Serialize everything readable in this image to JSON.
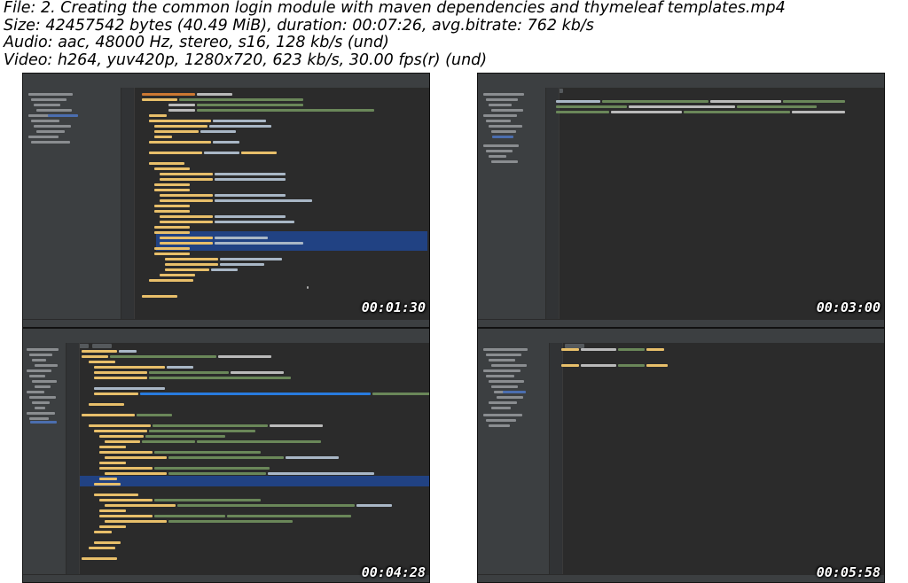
{
  "info": {
    "file_line": "File: 2. Creating the common login module with maven dependencies and thymeleaf templates.mp4",
    "size_line": "Size: 42457542 bytes (40.49 MiB), duration: 00:07:26, avg.bitrate: 762 kb/s",
    "audio_line": "Audio: aac, 48000 Hz, stereo, s16, 128 kb/s (und)",
    "video_line": "Video: h264, yuv420p, 1280x720, 623 kb/s, 30.00 fps(r) (und)"
  },
  "thumbnails": [
    {
      "timestamp": "00:01:30",
      "content": "pom.xml with maven dependencies"
    },
    {
      "timestamp": "00:03:00",
      "content": "html template with bootstrap script tags"
    },
    {
      "timestamp": "00:04:28",
      "content": "thymeleaf template with navbar and sec:authorize"
    },
    {
      "timestamp": "00:05:58",
      "content": "thymeleaf fragment header"
    }
  ],
  "colors": {
    "editor_bg": "#2b2b2b",
    "panel_bg": "#3c3f41",
    "selection": "#214283",
    "xml_tag": "#e8bf6a",
    "xml_attr": "#bababa",
    "string": "#6a8759",
    "text": "#a9b7c6",
    "keyword": "#cc7832",
    "link": "#287bde"
  }
}
